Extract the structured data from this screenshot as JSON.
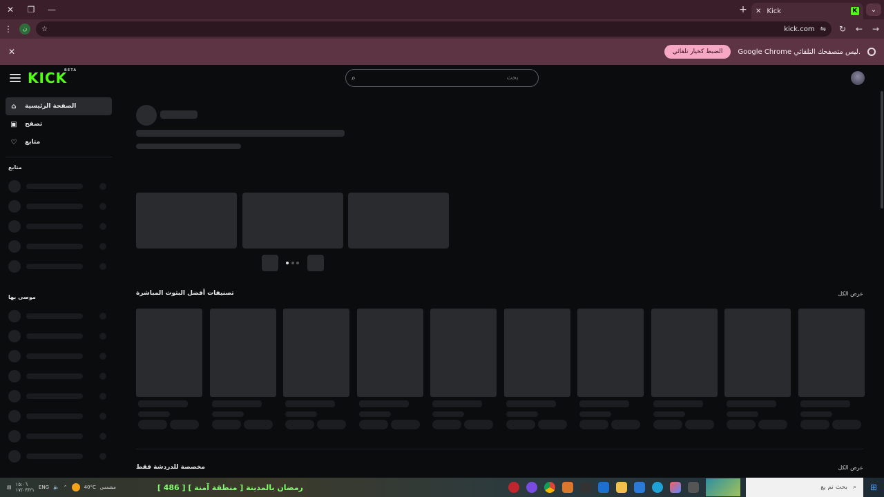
{
  "browser": {
    "tab_title": "Kick",
    "tab_favicon": "K",
    "url": "kick.com",
    "profile_letter": "ن",
    "new_tab_label": "+",
    "infobar": {
      "message": "Google Chrome ليس متصفحك التلقائي.",
      "button": "الضبط كخيار تلقائي"
    }
  },
  "header": {
    "logo": "KICK",
    "logo_badge": "BETA",
    "search_placeholder": "بحث"
  },
  "sidebar": {
    "nav": [
      {
        "label": "الصفحة الرئيسية",
        "icon": "home-icon"
      },
      {
        "label": "تصفح",
        "icon": "browse-icon"
      },
      {
        "label": "متابع",
        "icon": "heart-icon"
      }
    ],
    "following_title": "متابع",
    "recommended_title": "موصى بها"
  },
  "main": {
    "top_categories_title": "تصنيفات أفضل البثوث المباشرة",
    "top_categories_see_all": "عرض الكل",
    "chat_only_title": "مخصصة للدردشة فقط",
    "chat_only_see_all": "عرض الكل",
    "carousel_active_page": 1,
    "carousel_pages": 3
  },
  "taskbar": {
    "date": "١٧/٠٣/٢١",
    "time": "١٥:٠٦",
    "lang": "ENG",
    "weather": "40°C",
    "weather_text": "مشمس",
    "ticker": "[ 486 ] رمضان بالمدينة [ منطقة آمنة ]",
    "search_placeholder": "بحث نم يع"
  },
  "colors": {
    "kick_green": "#53fc18",
    "chrome_frame": "#3a1f2a",
    "infobar": "#5d3444",
    "infobar_button": "#f6a7c3",
    "page_bg": "#0b0c0e",
    "skeleton": "#1c1d21"
  }
}
